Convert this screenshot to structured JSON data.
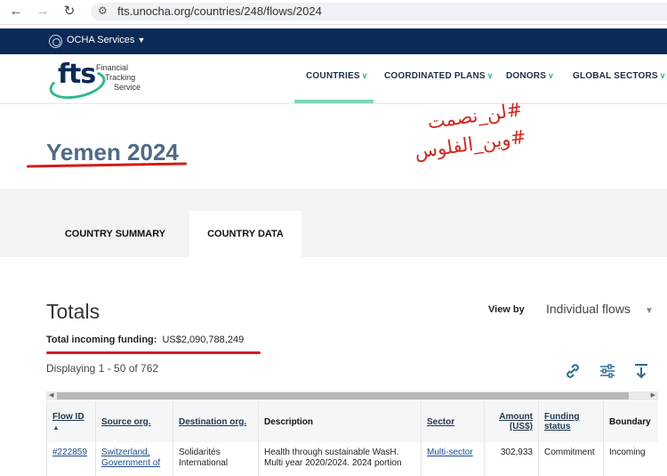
{
  "browser": {
    "back_icon": "arrow-left-icon",
    "forward_icon": "arrow-right-icon",
    "reload_icon": "reload-icon",
    "site_info_icon": "tune-icon",
    "url": "fts.unocha.org/countries/248/flows/2024"
  },
  "ocha_bar": {
    "label": "OCHA Services",
    "chevron": "chevron-down-icon"
  },
  "brand": {
    "word": "fts",
    "name_lines": [
      "Financial",
      "Tracking",
      "Service"
    ]
  },
  "topnav": [
    "COUNTRIES",
    "COORDINATED PLANS",
    "DONORS",
    "GLOBAL SECTORS"
  ],
  "page": {
    "title": "Yemen 2024"
  },
  "annotation": {
    "line1": "#لن_نصمت",
    "line2": "#وين_الفلوس"
  },
  "tabs": [
    {
      "label": "COUNTRY SUMMARY",
      "active": false
    },
    {
      "label": "COUNTRY DATA",
      "active": true
    }
  ],
  "totals": {
    "heading": "Totals",
    "view_by_label": "View by",
    "view_by_value": "Individual flows",
    "incoming_label": "Total incoming funding:",
    "incoming_amount": "US$2,090,788,249",
    "displaying": "Displaying 1 - 50 of 762"
  },
  "tools": [
    "link-icon",
    "filter-sliders-icon",
    "download-icon"
  ],
  "table": {
    "headers": [
      "Flow ID",
      "Source org.",
      "Destination org.",
      "Description",
      "Sector",
      "Amount (US$)",
      "Funding status",
      "Boundary"
    ],
    "header_amount_line1": "Amount",
    "header_amount_line2": "(US$)",
    "header_status_line1": "Funding",
    "header_status_line2": "status",
    "rows": [
      {
        "flow_id": "#222859",
        "source_line1": "Switzerland,",
        "source_line2": "Government of",
        "destination_line1": "Solidarités",
        "destination_line2": "International",
        "description_line1": "Health through sustainable WasH.",
        "description_line2": "Multi year 2020/2024. 2024 portion",
        "sector": "Multi-sector",
        "amount": "302,933",
        "status": "Commitment",
        "boundary": "Incoming"
      }
    ]
  },
  "colors": {
    "navy": "#0b2a55",
    "accent": "#2fb88d",
    "annotation_red": "#d41b1b",
    "title": "#4f6a87"
  }
}
